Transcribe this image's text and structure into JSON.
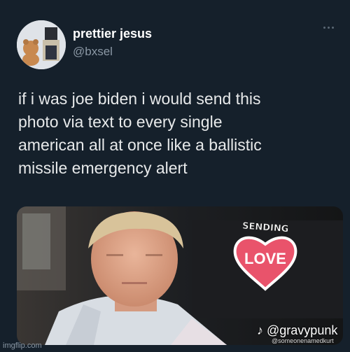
{
  "tweet": {
    "display_name": "prettier jesus",
    "handle": "@bxsel",
    "text_lines": [
      "if i was joe biden i would send this",
      "photo via text to every single",
      "american all at once like a ballistic",
      "missile emergency alert"
    ]
  },
  "media": {
    "sticker_top": "SENDING",
    "sticker_main": "LOVE",
    "tiktok_user": "@gravypunk",
    "tiktok_sub": "@someonenamedkurt",
    "heart_color": "#e9536b"
  },
  "watermark": "imgflip.com",
  "icons": {
    "more": "more-options-icon",
    "tiktok": "tiktok-logo-icon"
  }
}
